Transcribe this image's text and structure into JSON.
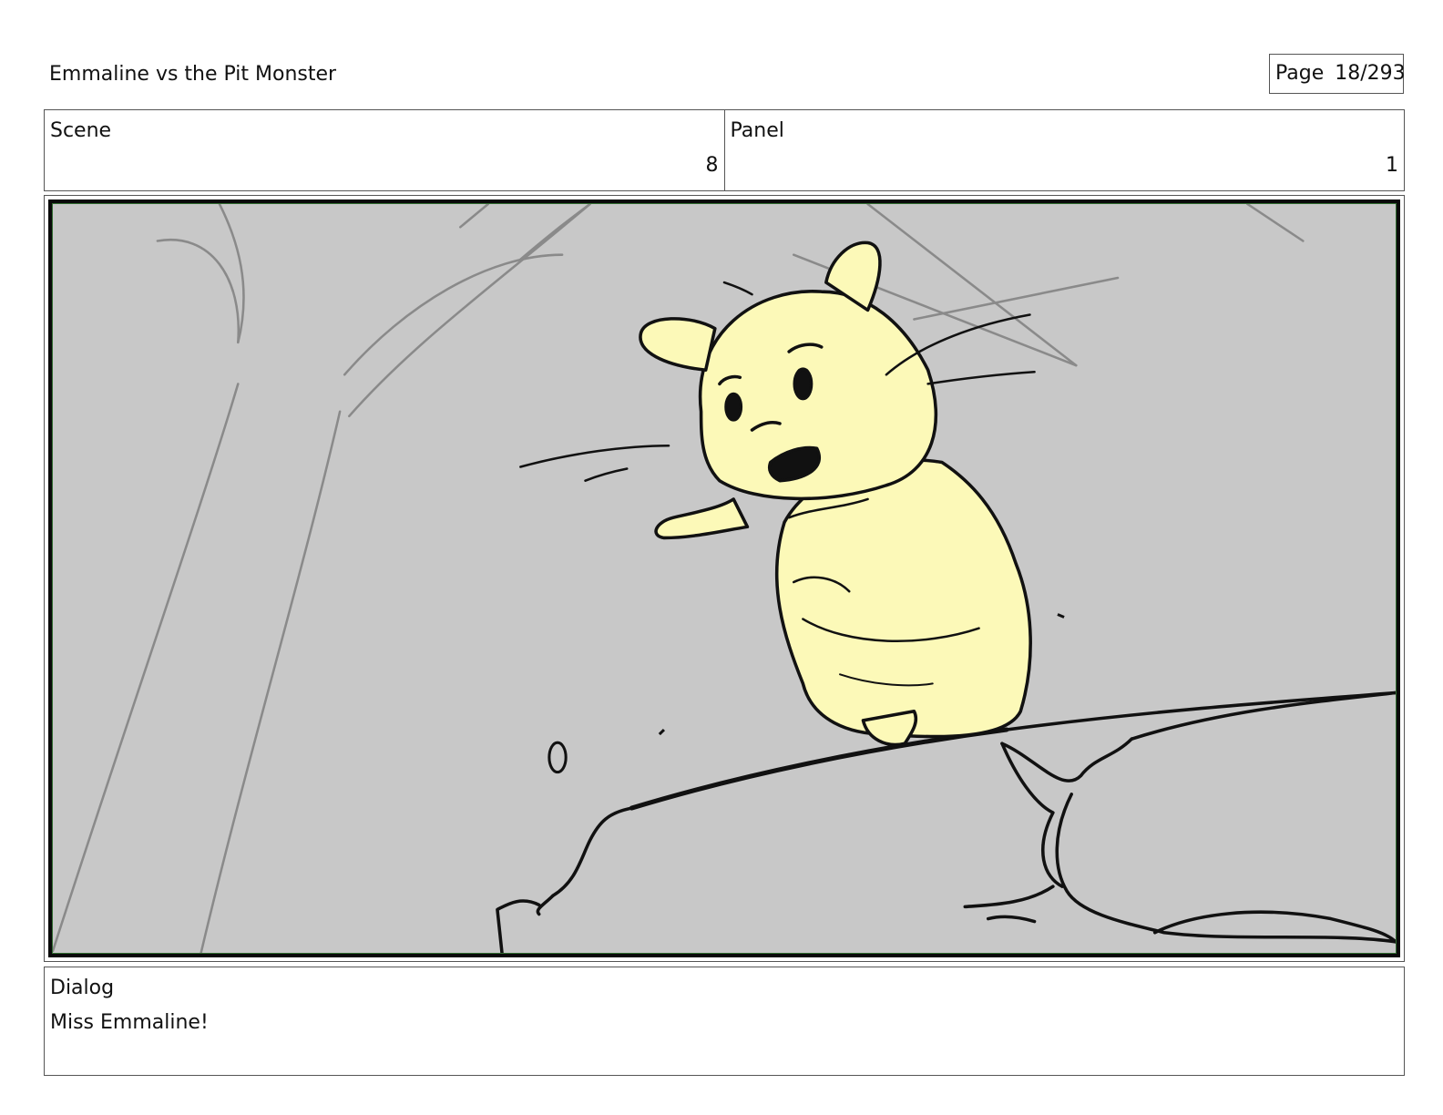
{
  "header": {
    "title": "Emmaline vs the Pit Monster",
    "page_label": "Page",
    "page_number": "18/293"
  },
  "scene": {
    "label": "Scene",
    "value": "8"
  },
  "panel": {
    "label": "Panel",
    "value": "1"
  },
  "artwork": {
    "subject": "hamster-sketch",
    "background_color": "#c8c8c8",
    "character_color": "#fcf9b8",
    "border_color": "#2f6b2f"
  },
  "dialog": {
    "label": "Dialog",
    "text": "Miss Emmaline!"
  }
}
